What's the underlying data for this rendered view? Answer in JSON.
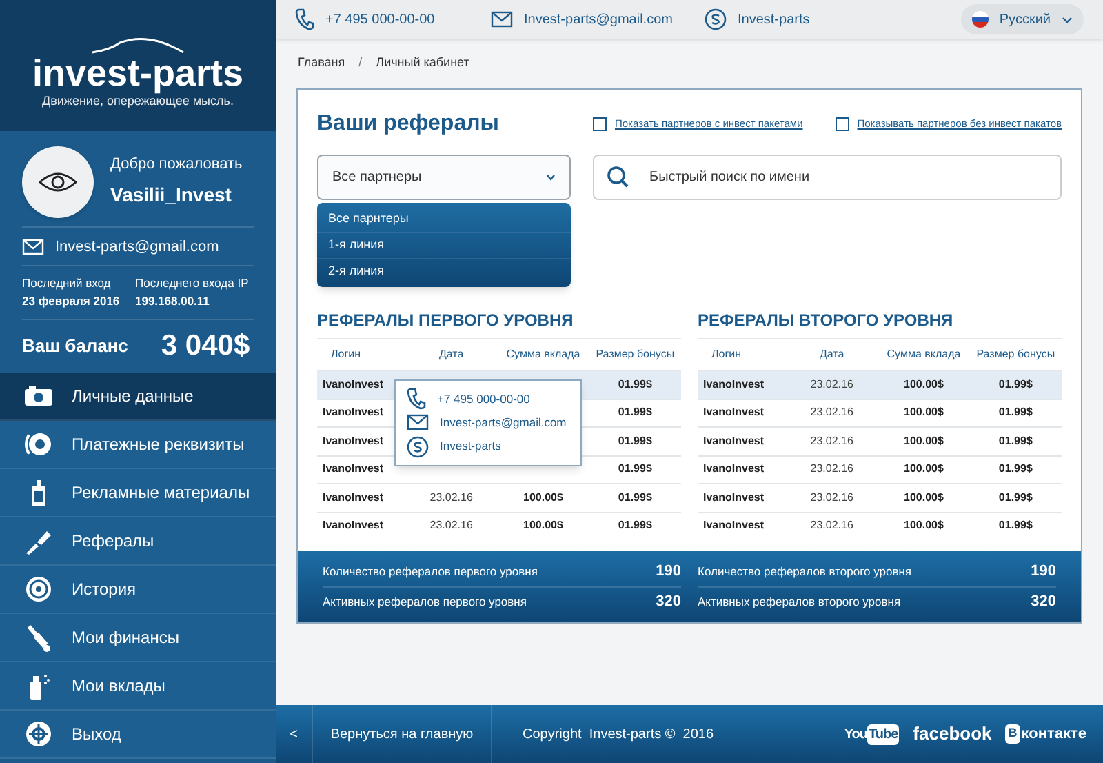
{
  "brand": {
    "name": "invest-parts",
    "tagline": "Движение, опережающее мысль."
  },
  "profile": {
    "greeting": "Добро пожаловать",
    "username": "Vasilii_Invest",
    "email": "Invest-parts@gmail.com",
    "last_login_label": "Последний вход",
    "last_login": "23 февраля 2016",
    "last_ip_label": "Последнего входа IP",
    "last_ip": "199.168.00.11",
    "balance_label": "Ваш баланс",
    "balance": "3 040$"
  },
  "menu": [
    {
      "label": "Личные данные",
      "selected": true
    },
    {
      "label": "Платежные реквизиты",
      "selected": false
    },
    {
      "label": "Рекламные материалы",
      "selected": false
    },
    {
      "label": "Рефералы",
      "selected": false
    },
    {
      "label": "История",
      "selected": false
    },
    {
      "label": "Мои финансы",
      "selected": false
    },
    {
      "label": "Мои вклады",
      "selected": false
    },
    {
      "label": "Выход",
      "selected": false
    }
  ],
  "topbar": {
    "phone": "+7 495 000-00-00",
    "email": "Invest-parts@gmail.com",
    "skype": "Invest-parts",
    "language": "Русский"
  },
  "breadcrumb": [
    {
      "kind": "link",
      "text": "Главаня"
    },
    {
      "kind": "separator",
      "text": "/"
    },
    {
      "kind": "link",
      "text": "Личный кабинет"
    }
  ],
  "card": {
    "title": "Ваши рефералы",
    "filters": [
      {
        "label": "Показать партнеров с инвест пакетами",
        "checked": false
      },
      {
        "label": "Показывать партнеров без инвест пакатов",
        "checked": false
      }
    ],
    "dropdown": {
      "value": "Все партнеры",
      "expanded": true,
      "options": [
        "Все парнтеры",
        "1-я линия",
        "2-я линия"
      ]
    },
    "search": {
      "placeholder": "Быстрый поиск по имени"
    },
    "tables": [
      {
        "title": "РЕФЕРАЛЫ ПЕРВОГО УРОВНЯ",
        "columns": [
          "Логин",
          "Дата",
          "Сумма вклада",
          "Размер бонусы"
        ],
        "rows": [
          {
            "login": "IvanoInvest",
            "bonus": "01.99$",
            "selected": true
          },
          {
            "login": "IvanoInvest",
            "bonus": "01.99$",
            "selected": false
          },
          {
            "login": "IvanoInvest",
            "bonus": "01.99$",
            "selected": false
          },
          {
            "login": "IvanoInvest",
            "bonus": "01.99$",
            "selected": false
          },
          {
            "login": "IvanoInvest",
            "date": "23.02.16",
            "amount": "100.00$",
            "bonus": "01.99$",
            "selected": false
          },
          {
            "login": "IvanoInvest",
            "date": "23.02.16",
            "amount": "100.00$",
            "bonus": "01.99$",
            "selected": false
          }
        ],
        "stats": [
          {
            "label": "Количество рефералов первого уровня",
            "value": "190"
          },
          {
            "label": "Активных рефералов первого уровня",
            "value": "320"
          }
        ]
      },
      {
        "title": "РЕФЕРАЛЫ ВТОРОГО УРОВНЯ",
        "columns": [
          "Логин",
          "Дата",
          "Сумма вклада",
          "Размер бонусы"
        ],
        "rows": [
          {
            "login": "IvanoInvest",
            "date": "23.02.16",
            "amount": "100.00$",
            "bonus": "01.99$",
            "selected": true
          },
          {
            "login": "IvanoInvest",
            "date": "23.02.16",
            "amount": "100.00$",
            "bonus": "01.99$",
            "selected": false
          },
          {
            "login": "IvanoInvest",
            "date": "23.02.16",
            "amount": "100.00$",
            "bonus": "01.99$",
            "selected": false
          },
          {
            "login": "IvanoInvest",
            "date": "23.02.16",
            "amount": "100.00$",
            "bonus": "01.99$",
            "selected": false
          },
          {
            "login": "IvanoInvest",
            "date": "23.02.16",
            "amount": "100.00$",
            "bonus": "01.99$",
            "selected": false
          },
          {
            "login": "IvanoInvest",
            "date": "23.02.16",
            "amount": "100.00$",
            "bonus": "01.99$",
            "selected": false
          }
        ],
        "stats": [
          {
            "label": "Количество рефералов второго уровня",
            "value": "190"
          },
          {
            "label": "Активных рефералов второго уровня",
            "value": "320"
          }
        ]
      }
    ],
    "tooltip": {
      "phone": "+7 495 000-00-00",
      "email": "Invest-parts@gmail.com",
      "skype": "Invest-parts"
    }
  },
  "footer": {
    "back_arrow": "<",
    "back_label": "Вернуться на главную",
    "copyright": "Copyright  Invest-parts ©  2016",
    "social": [
      {
        "kind": "youtube",
        "text": "You",
        "boxed": "Tube"
      },
      {
        "kind": "facebook",
        "text": "facebook"
      },
      {
        "kind": "vk",
        "boxed": "В",
        "text": "контакте"
      }
    ]
  }
}
